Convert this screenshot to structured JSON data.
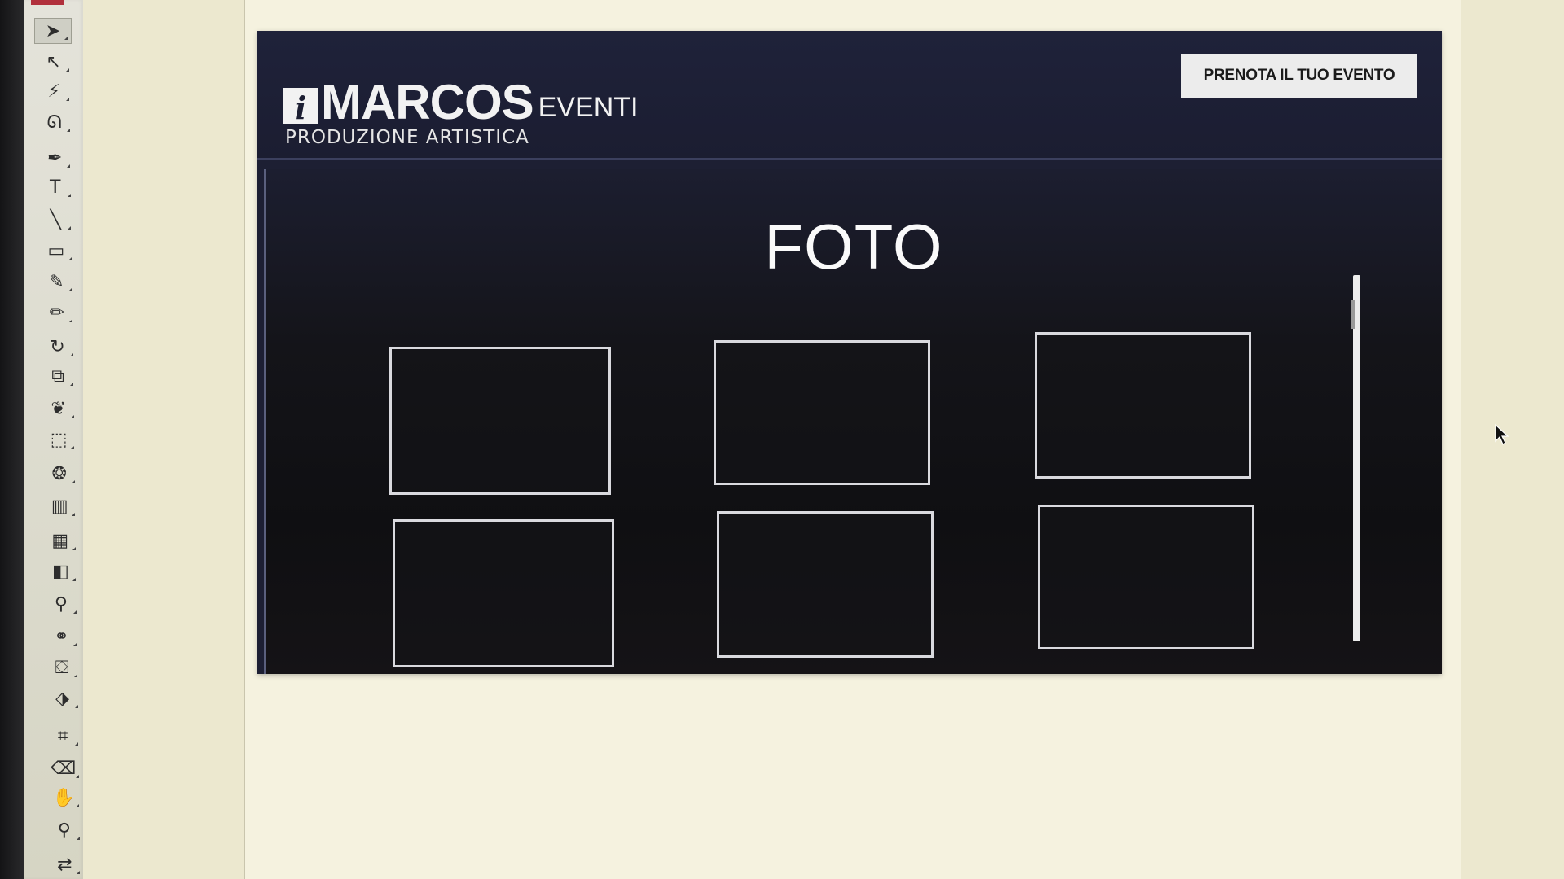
{
  "toolbar": {
    "tools": [
      {
        "name": "selection-tool-icon",
        "glyph": "➤",
        "active": true
      },
      {
        "name": "direct-selection-tool-icon",
        "glyph": "↖"
      },
      {
        "name": "magic-wand-tool-icon",
        "glyph": "⚡"
      },
      {
        "name": "lasso-tool-icon",
        "glyph": "ᘏ"
      },
      {
        "name": "pen-tool-icon",
        "glyph": "✒"
      },
      {
        "name": "type-tool-icon",
        "glyph": "T"
      },
      {
        "name": "line-tool-icon",
        "glyph": "╲"
      },
      {
        "name": "rectangle-tool-icon",
        "glyph": "▭"
      },
      {
        "name": "paintbrush-tool-icon",
        "glyph": "✎"
      },
      {
        "name": "pencil-tool-icon",
        "glyph": "✏"
      },
      {
        "name": "rotate-tool-icon",
        "glyph": "↻"
      },
      {
        "name": "scale-tool-icon",
        "glyph": "⧉"
      },
      {
        "name": "warp-tool-icon",
        "glyph": "❦"
      },
      {
        "name": "free-transform-tool-icon",
        "glyph": "⬚"
      },
      {
        "name": "symbol-sprayer-tool-icon",
        "glyph": "❂"
      },
      {
        "name": "graph-tool-icon",
        "glyph": "▥"
      },
      {
        "name": "mesh-tool-icon",
        "glyph": "▦"
      },
      {
        "name": "gradient-tool-icon",
        "glyph": "◧"
      },
      {
        "name": "eyedropper-tool-icon",
        "glyph": "⚲"
      },
      {
        "name": "blend-tool-icon",
        "glyph": "⚭"
      },
      {
        "name": "live-paint-tool-icon",
        "glyph": "⛋"
      },
      {
        "name": "live-paint-selection-tool-icon",
        "glyph": "⬗"
      },
      {
        "name": "slice-tool-icon",
        "glyph": "⌗"
      },
      {
        "name": "eraser-tool-icon",
        "glyph": "⌫"
      },
      {
        "name": "hand-tool-icon",
        "glyph": "✋"
      },
      {
        "name": "zoom-tool-icon",
        "glyph": "⚲"
      },
      {
        "name": "swap-fill-stroke-icon",
        "glyph": "⇄"
      }
    ]
  },
  "site": {
    "logo": {
      "mark": "i",
      "name": "MARCOS",
      "suffix": "EVENTI",
      "tagline": "PRODUZIONE ARTISTICA"
    },
    "cta_label": "PRENOTA IL TUO EVENTO",
    "page_title": "FOTO",
    "photo_count": 6
  }
}
